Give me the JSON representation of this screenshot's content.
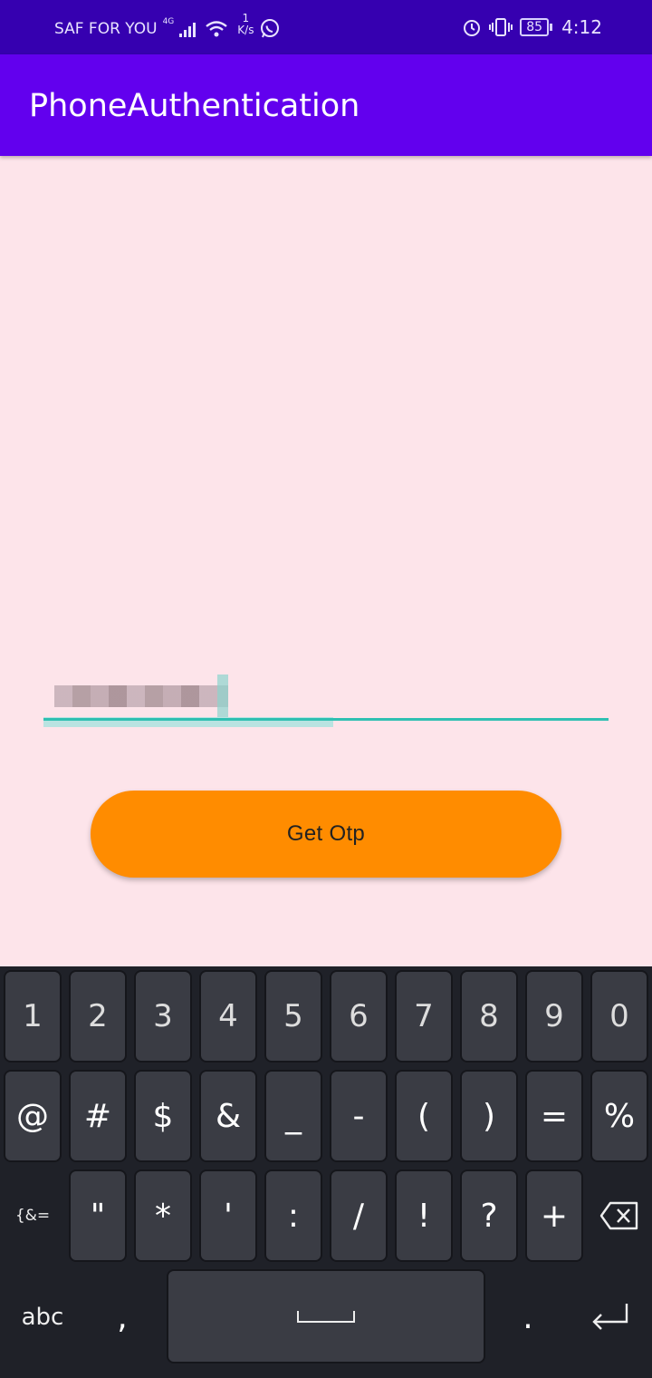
{
  "status_bar": {
    "carrier": "SAF FOR YOU",
    "network": "4G",
    "speed_value": "1",
    "speed_unit": "K/s",
    "battery": "85",
    "time": "4:12"
  },
  "app_bar": {
    "title": "PhoneAuthentication"
  },
  "form": {
    "phone_value": "",
    "button_label": "Get Otp"
  },
  "keyboard": {
    "row1": [
      "1",
      "2",
      "3",
      "4",
      "5",
      "6",
      "7",
      "8",
      "9",
      "0"
    ],
    "row2": [
      "@",
      "#",
      "$",
      "&",
      "_",
      "-",
      "(",
      ")",
      "=",
      "%"
    ],
    "row3": [
      "{&=",
      "\"",
      "*",
      "'",
      ":",
      "/",
      "!",
      "?",
      "+"
    ],
    "row4": [
      "abc",
      ",",
      ".",
      ""
    ]
  }
}
